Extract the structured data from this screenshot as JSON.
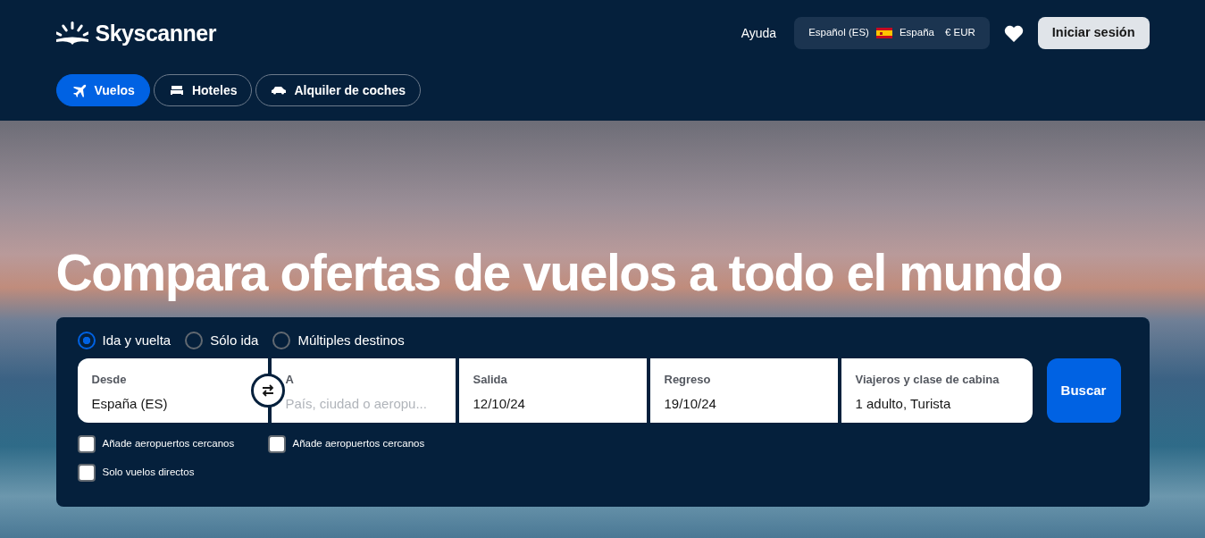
{
  "header": {
    "logo": "Skyscanner",
    "help": "Ayuda",
    "locale": {
      "language": "Español (ES)",
      "country": "España",
      "currency": "€ EUR"
    },
    "login": "Iniciar sesión"
  },
  "tabs": [
    {
      "label": "Vuelos",
      "kind": "plane",
      "selected": true
    },
    {
      "label": "Hoteles",
      "kind": "bed",
      "selected": false
    },
    {
      "label": "Alquiler de coches",
      "kind": "car",
      "selected": false
    }
  ],
  "hero": {
    "headline": "Compara ofertas de vuelos a todo el mundo"
  },
  "search": {
    "trip_types": [
      {
        "label": "Ida y vuelta",
        "selected": true
      },
      {
        "label": "Sólo ida",
        "selected": false
      },
      {
        "label": "Múltiples destinos",
        "selected": false
      }
    ],
    "fields": [
      {
        "label": "Desde",
        "value": "España (ES)"
      },
      {
        "label": "A",
        "placeholder": "País, ciudad o aeropu..."
      },
      {
        "label": "Salida",
        "value": "12/10/24"
      },
      {
        "label": "Regreso",
        "value": "19/10/24"
      },
      {
        "label": "Viajeros y clase de cabina",
        "value": "1 adulto, Turista"
      }
    ],
    "search_button": "Buscar",
    "options": [
      [
        {
          "label": "Añade aeropuertos cercanos",
          "checked": false
        },
        {
          "label": "Añade aeropuertos cercanos",
          "checked": false
        }
      ],
      [
        {
          "label": "Solo vuelos directos",
          "checked": false
        }
      ]
    ]
  }
}
